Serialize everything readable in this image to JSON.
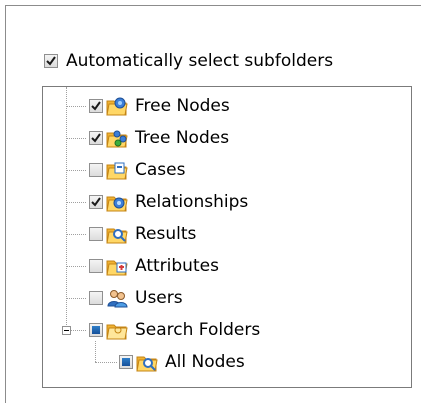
{
  "auto_select": {
    "label": "Automatically select subfolders",
    "checked": true
  },
  "tree": {
    "nodes": [
      {
        "label": "Free Nodes",
        "state": "checked",
        "icon": "free-nodes-folder-icon",
        "selected": true
      },
      {
        "label": "Tree Nodes",
        "state": "checked",
        "icon": "tree-nodes-folder-icon"
      },
      {
        "label": "Cases",
        "state": "unchecked",
        "icon": "cases-folder-icon"
      },
      {
        "label": "Relationships",
        "state": "checked",
        "icon": "relationships-folder-icon"
      },
      {
        "label": "Results",
        "state": "unchecked",
        "icon": "results-folder-icon"
      },
      {
        "label": "Attributes",
        "state": "unchecked",
        "icon": "attributes-folder-icon"
      },
      {
        "label": "Users",
        "state": "unchecked",
        "icon": "users-icon"
      },
      {
        "label": "Search Folders",
        "state": "partial",
        "icon": "search-folders-icon",
        "expanded": true
      },
      {
        "label": "All Nodes",
        "state": "partial",
        "icon": "all-nodes-search-icon"
      }
    ]
  }
}
